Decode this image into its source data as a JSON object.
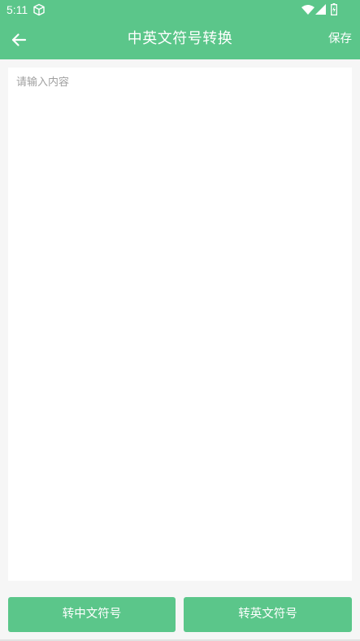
{
  "status_bar": {
    "time": "5:11",
    "icons": [
      "cube-icon",
      "wifi-icon",
      "signal-icon",
      "battery-icon"
    ]
  },
  "app_bar": {
    "title": "中英文符号转换",
    "save_label": "保存",
    "back_icon": "arrow-left-icon"
  },
  "editor": {
    "placeholder": "请输入内容",
    "value": ""
  },
  "actions": {
    "to_chinese_label": "转中文符号",
    "to_english_label": "转英文符号"
  },
  "colors": {
    "accent": "#5bc68a",
    "background": "#f6f6f6",
    "placeholder": "#a0a0a0"
  }
}
